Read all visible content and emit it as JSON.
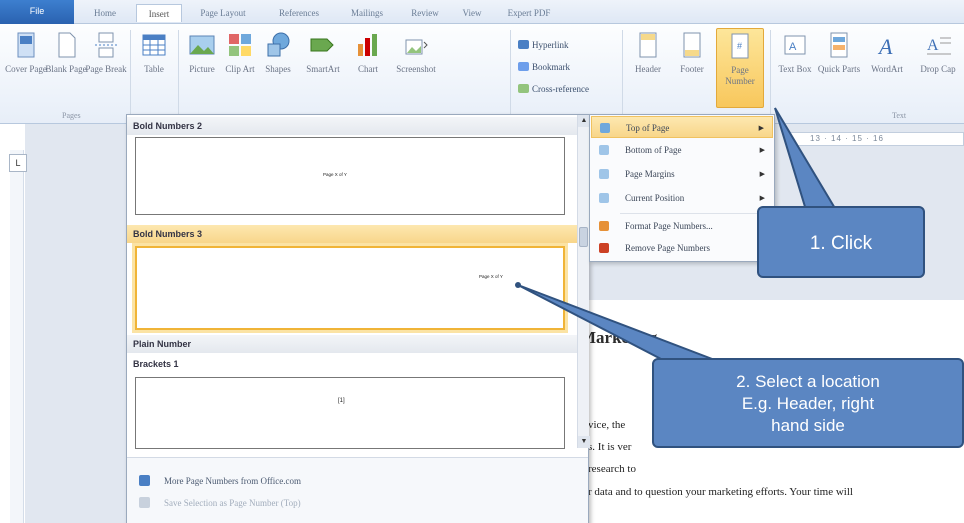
{
  "tabs": [
    "File",
    "Home",
    "Insert",
    "Page Layout",
    "References",
    "Mailings",
    "Review",
    "View",
    "Expert PDF"
  ],
  "active_tab": "Insert",
  "ribbon": {
    "cover_page": "Cover Page",
    "blank_page": "Blank Page",
    "page_break": "Page Break",
    "pages_group": "Pages",
    "table": "Table",
    "picture": "Picture",
    "clip_art": "Clip Art",
    "shapes": "Shapes",
    "smartart": "SmartArt",
    "chart": "Chart",
    "screenshot": "Screenshot",
    "hyperlink": "Hyperlink",
    "bookmark": "Bookmark",
    "cross_reference": "Cross-reference",
    "header": "Header",
    "footer": "Footer",
    "page_number": "Page Number",
    "text_box": "Text Box",
    "quick_parts": "Quick Parts",
    "wordart": "WordArt",
    "drop_cap": "Drop Cap",
    "text_group": "Text"
  },
  "ruler_tab_marker": "L",
  "ruler_numbers": "13 · 14 · 15 · 16",
  "gallery": {
    "section1": "Bold Numbers 2",
    "section1_preview": "Page X of Y",
    "section2": "Bold Numbers 3",
    "section2_preview": "Page X of Y",
    "section3": "Plain Number",
    "section4": "Brackets 1",
    "section4_preview": "[1]",
    "more_link": "More Page Numbers from Office.com",
    "save_selection": "Save Selection as Page Number (Top)"
  },
  "submenu": {
    "items": [
      "Top of Page",
      "Bottom of Page",
      "Page Margins",
      "Current Position",
      "Format Page Numbers...",
      "Remove Page Numbers"
    ],
    "selected": "Top of Page"
  },
  "document": {
    "heading": "Marketing",
    "line1": "vice, the",
    "line2": "s. It is ver",
    "line3": "research to",
    "line4": "r data and to question your marketing efforts. Your time will"
  },
  "callouts": {
    "step1": "1. Click",
    "step2_line1": "2. Select a location",
    "step2_line2": "E.g. Header, right",
    "step2_line3": "hand side"
  },
  "colors": {
    "file_tab": "#2a62b0",
    "highlight": "#f8c75c",
    "callout_fill": "#5b86c2",
    "callout_border": "#30527f"
  }
}
